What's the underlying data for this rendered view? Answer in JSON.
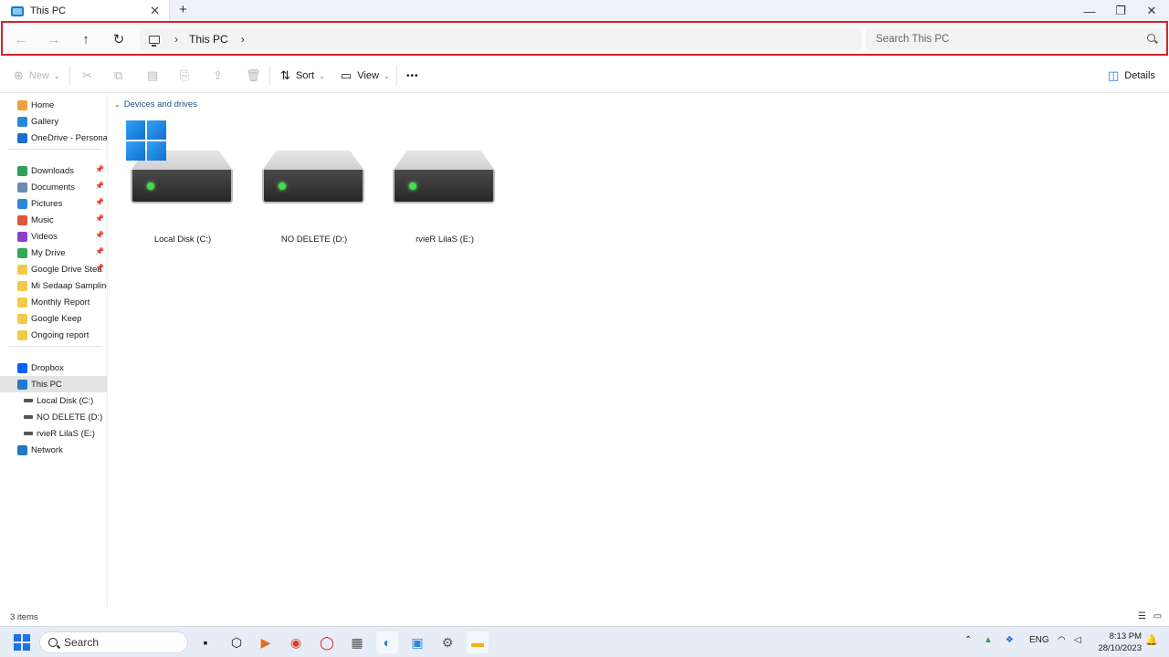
{
  "window": {
    "tab_title": "This PC",
    "new_tab": "+",
    "close_tab": "✕",
    "minimize": "—",
    "restore": "❐",
    "close": "✕"
  },
  "nav": {
    "back": "←",
    "forward": "→",
    "up": "↑",
    "refresh": "↻",
    "breadcrumb": [
      "This PC"
    ],
    "search_placeholder": "Search This PC"
  },
  "toolbar": {
    "new_label": "New",
    "sort_label": "Sort",
    "view_label": "View",
    "more_label": "•••",
    "details_label": "Details"
  },
  "sidebar": {
    "items": [
      {
        "label": "Home",
        "icon": "home-icon",
        "color": "#e8a33d"
      },
      {
        "label": "Gallery",
        "icon": "gallery-icon",
        "color": "#2b88d8"
      },
      {
        "label": "OneDrive - Personal",
        "icon": "cloud-icon",
        "color": "#1c6fd0"
      },
      {
        "label": "Downloads",
        "icon": "download-icon",
        "color": "#2e9e5b",
        "pinned": true
      },
      {
        "label": "Documents",
        "icon": "document-icon",
        "color": "#6b8bb5",
        "pinned": true
      },
      {
        "label": "Pictures",
        "icon": "picture-icon",
        "color": "#2b88d8",
        "pinned": true
      },
      {
        "label": "Music",
        "icon": "music-icon",
        "color": "#e0553b",
        "pinned": true
      },
      {
        "label": "Videos",
        "icon": "video-icon",
        "color": "#8a3fd1",
        "pinned": true
      },
      {
        "label": "My Drive",
        "icon": "google-drive-icon",
        "color": "#34a853",
        "pinned": true
      },
      {
        "label": "Google Drive Stea",
        "icon": "folder-icon",
        "color": "#f2c94c",
        "pinned": true
      },
      {
        "label": "Mi Sedaap Sampling",
        "icon": "google-drive-folder-icon",
        "color": "#f2c94c"
      },
      {
        "label": "Monthly Report",
        "icon": "folder-icon",
        "color": "#f2c94c"
      },
      {
        "label": "Google Keep",
        "icon": "google-drive-folder-icon",
        "color": "#f2c94c"
      },
      {
        "label": "Ongoing report",
        "icon": "folder-icon",
        "color": "#f2c94c"
      },
      {
        "label": "Dropbox",
        "icon": "dropbox-icon",
        "color": "#0061fe"
      },
      {
        "label": "This PC",
        "icon": "computer-icon",
        "color": "#1f78c8",
        "selected": true
      },
      {
        "label": "Local Disk (C:)",
        "icon": "drive-icon",
        "color": "#555555"
      },
      {
        "label": "NO DELETE (D:)",
        "icon": "drive-icon",
        "color": "#555555"
      },
      {
        "label": "rvieR LilaS (E:)",
        "icon": "drive-icon",
        "color": "#555555"
      },
      {
        "label": "Network",
        "icon": "network-icon",
        "color": "#1f78c8"
      }
    ]
  },
  "content": {
    "group_label": "Devices and drives",
    "drives": [
      {
        "label": "Local Disk (C:)",
        "system": true
      },
      {
        "label": "NO DELETE (D:)",
        "system": false
      },
      {
        "label": "rvieR LilaS (E:)",
        "system": false
      }
    ]
  },
  "status": {
    "item_count": "3 items"
  },
  "taskbar": {
    "search_label": "Search",
    "language": "ENG",
    "time": "8:13 PM",
    "date": "28/10/2023"
  },
  "colors": {
    "accent": "#1f78c8",
    "highlight_border": "#d9202a"
  }
}
